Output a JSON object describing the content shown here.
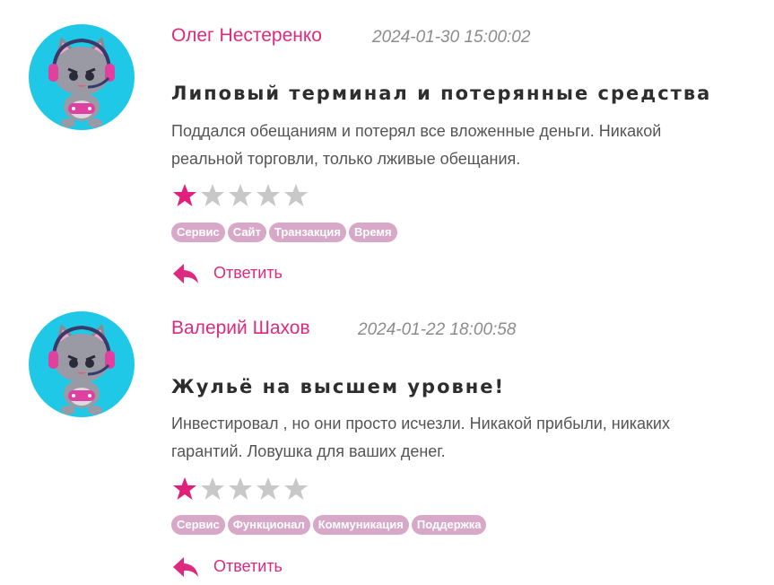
{
  "reviews": [
    {
      "author": "Олег Нестеренко",
      "date": "2024-01-30 15:00:02",
      "title": "Липовый терминал и потерянные средства",
      "text": "Поддался обещаниям и потерял все вложенные деньги. Никакой реальной торговли, только лживые обещания.",
      "rating": 1,
      "rating_max": 5,
      "tags": [
        "Сервис",
        "Сайт",
        "Транзакция",
        "Время"
      ],
      "reply_label": "Ответить"
    },
    {
      "author": "Валерий Шахов",
      "date": "2024-01-22 18:00:58",
      "title": "Жульё на высшем уровне!",
      "text": "Инвестировал , но они просто исчезли. Никакой прибыли, никаких гарантий. Ловушка для ваших денег.",
      "rating": 1,
      "rating_max": 5,
      "tags": [
        "Сервис",
        "Функционал",
        "Коммуникация",
        "Поддержка"
      ],
      "reply_label": "Ответить"
    }
  ],
  "colors": {
    "accent": "#dd2a7e",
    "star_filled": "#e0207a",
    "star_empty": "#c8c8c8",
    "tag_bg": "#d8a8c8",
    "avatar_bg": "#20c8e8"
  },
  "icons": {
    "avatar": "gamer-cat-avatar-icon",
    "reply": "reply-arrow-icon",
    "star": "star-icon"
  }
}
